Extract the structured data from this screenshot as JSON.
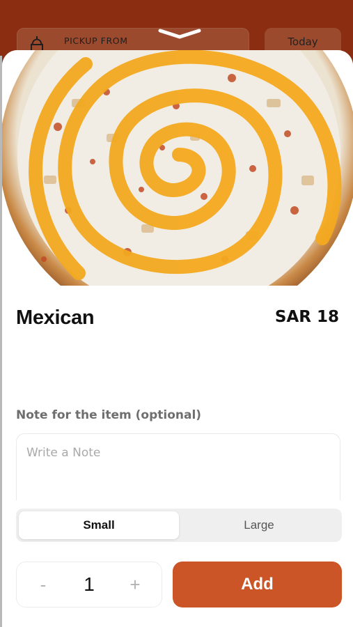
{
  "header": {
    "pickup_label": "PICKUP FROM",
    "date_label": "Today"
  },
  "item": {
    "name": "Mexican",
    "price": "SAR 18",
    "image": "pizza-photo"
  },
  "note": {
    "label": "Note for the item (optional)",
    "placeholder": "Write a Note",
    "value": ""
  },
  "size": {
    "options": [
      "Small",
      "Large"
    ],
    "selected": "Small"
  },
  "quantity": {
    "minus_label": "-",
    "count": "1",
    "plus_label": "+"
  },
  "actions": {
    "add_label": "Add"
  },
  "colors": {
    "accent": "#cc5527",
    "background_header": "#8a2d10"
  }
}
